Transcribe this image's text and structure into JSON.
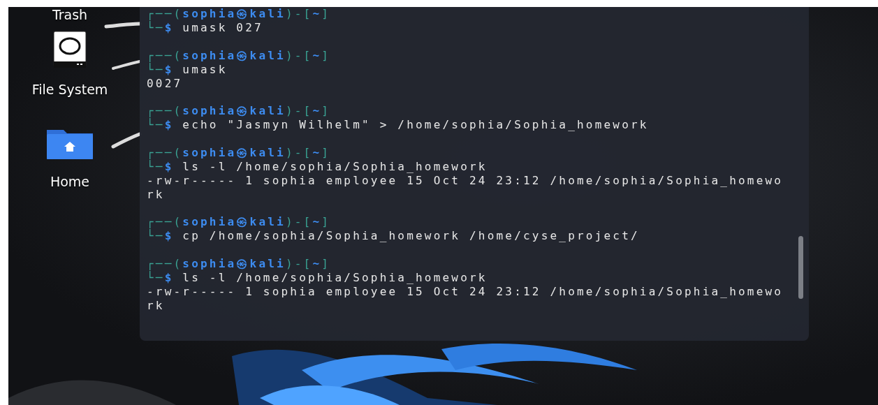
{
  "desktop_icons": [
    {
      "kind": "trash",
      "label": "Trash"
    },
    {
      "kind": "drive",
      "label": "File System"
    },
    {
      "kind": "home",
      "label": "Home"
    }
  ],
  "terminal": {
    "blocks": [
      {
        "prompt": {
          "frame_top": "┌──(",
          "user": "sophia",
          "at": "㉿",
          "host": "kali",
          "mid": ")-[",
          "dir": "~",
          "close": "]",
          "frame_bottom": "└─",
          "sign": "$",
          "command": "umask 027"
        }
      },
      {
        "prompt": {
          "frame_top": "┌──(",
          "user": "sophia",
          "at": "㉿",
          "host": "kali",
          "mid": ")-[",
          "dir": "~",
          "close": "]",
          "frame_bottom": "└─",
          "sign": "$",
          "command": "umask"
        },
        "output": [
          "0027"
        ]
      },
      {
        "prompt": {
          "frame_top": "┌──(",
          "user": "sophia",
          "at": "㉿",
          "host": "kali",
          "mid": ")-[",
          "dir": "~",
          "close": "]",
          "frame_bottom": "└─",
          "sign": "$",
          "command": "echo \"Jasmyn Wilhelm\" > /home/sophia/Sophia_homework"
        }
      },
      {
        "prompt": {
          "frame_top": "┌──(",
          "user": "sophia",
          "at": "㉿",
          "host": "kali",
          "mid": ")-[",
          "dir": "~",
          "close": "]",
          "frame_bottom": "└─",
          "sign": "$",
          "command": "ls -l /home/sophia/Sophia_homework"
        },
        "output": [
          "-rw-r----- 1 sophia employee 15 Oct 24 23:12 /home/sophia/Sophia_homewo",
          "rk"
        ]
      },
      {
        "prompt": {
          "frame_top": "┌──(",
          "user": "sophia",
          "at": "㉿",
          "host": "kali",
          "mid": ")-[",
          "dir": "~",
          "close": "]",
          "frame_bottom": "└─",
          "sign": "$",
          "command": "cp /home/sophia/Sophia_homework /home/cyse_project/"
        }
      },
      {
        "prompt": {
          "frame_top": "┌──(",
          "user": "sophia",
          "at": "㉿",
          "host": "kali",
          "mid": ")-[",
          "dir": "~",
          "close": "]",
          "frame_bottom": "└─",
          "sign": "$",
          "command": "ls -l /home/sophia/Sophia_homework"
        },
        "output": [
          "-rw-r----- 1 sophia employee 15 Oct 24 23:12 /home/sophia/Sophia_homewo",
          "rk"
        ]
      }
    ]
  }
}
